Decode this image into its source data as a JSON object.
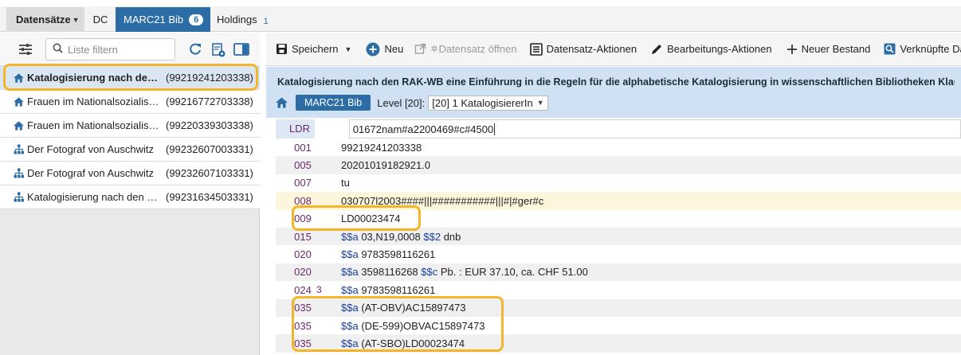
{
  "tabs": {
    "records_label": "Datensätze",
    "dc_label": "DC",
    "marc_label": "MARC21 Bib",
    "marc_count": "6",
    "holdings_label": "Holdings",
    "holdings_count": "1"
  },
  "left_panel": {
    "search_placeholder": "Liste filtern",
    "records": [
      {
        "icon": "home-icon",
        "title": "Katalogisierung nach den RAK-WB eine Einführung",
        "id": "(99219241203338)",
        "selected": true
      },
      {
        "icon": "home-icon",
        "title": "Frauen im Nationalsozialismus",
        "id": "(99216772703338)",
        "selected": false
      },
      {
        "icon": "home-icon",
        "title": "Frauen im Nationalsozialismus",
        "id": "(99220339303338)",
        "selected": false
      },
      {
        "icon": "hierarchy-icon",
        "title": "Der Fotograf von Auschwitz",
        "id": "(99232607003331)",
        "selected": false
      },
      {
        "icon": "hierarchy-icon",
        "title": "Der Fotograf von Auschwitz",
        "id": "(99232607103331)",
        "selected": false
      },
      {
        "icon": "hierarchy-icon",
        "title": "Katalogisierung nach den RAK-WB",
        "id": "(99231634503331)",
        "selected": false
      }
    ]
  },
  "toolbar": {
    "save_label": "Speichern",
    "new_label": "Neu",
    "open_record_label": "Datensatz öffnen",
    "record_actions_label": "Datensatz-Aktionen",
    "edit_actions_label": "Bearbeitungs-Aktionen",
    "new_holding_label": "Neuer Bestand",
    "linked_label": "Verknüpfte Da"
  },
  "record": {
    "title": "Katalogisierung nach den RAK-WB eine Einführung in die Regeln für die alphabetische Katalogisierung in wissenschaftlichen Bibliotheken Klaus H...",
    "format_chip": "MARC21 Bib",
    "level_label": "Level [20]:",
    "level_value": "[20] 1 KatalogisiererIn"
  },
  "marc_fields": [
    {
      "tag": "LDR",
      "ind": "",
      "parts": [
        {
          "t": "text",
          "v": "01672nam#a2200469#c#4500"
        }
      ]
    },
    {
      "tag": "001",
      "ind": "",
      "parts": [
        {
          "t": "text",
          "v": "99219241203338"
        }
      ]
    },
    {
      "tag": "005",
      "ind": "",
      "parts": [
        {
          "t": "text",
          "v": "20201019182921.0"
        }
      ]
    },
    {
      "tag": "007",
      "ind": "",
      "parts": [
        {
          "t": "text",
          "v": "tu"
        }
      ]
    },
    {
      "tag": "008",
      "ind": "",
      "parts": [
        {
          "t": "text",
          "v": "030707l2003####|||###########|||#|#ger#c"
        }
      ]
    },
    {
      "tag": "009",
      "ind": "",
      "parts": [
        {
          "t": "text",
          "v": "LD00023474"
        }
      ]
    },
    {
      "tag": "015",
      "ind": "",
      "parts": [
        {
          "t": "sub",
          "v": "$$a"
        },
        {
          "t": "text",
          "v": " 03,N19,0008 "
        },
        {
          "t": "sub",
          "v": "$$2"
        },
        {
          "t": "text",
          "v": " dnb"
        }
      ]
    },
    {
      "tag": "020",
      "ind": "",
      "parts": [
        {
          "t": "sub",
          "v": "$$a"
        },
        {
          "t": "text",
          "v": " 9783598116261"
        }
      ]
    },
    {
      "tag": "020",
      "ind": "",
      "parts": [
        {
          "t": "sub",
          "v": "$$a"
        },
        {
          "t": "text",
          "v": " 3598116268 "
        },
        {
          "t": "sub",
          "v": "$$c"
        },
        {
          "t": "text",
          "v": " Pb. : EUR 37.10, ca. CHF 51.00"
        }
      ]
    },
    {
      "tag": "024",
      "ind": "3",
      "parts": [
        {
          "t": "sub",
          "v": "$$a"
        },
        {
          "t": "text",
          "v": " 9783598116261"
        }
      ]
    },
    {
      "tag": "035",
      "ind": "",
      "parts": [
        {
          "t": "sub",
          "v": "$$a"
        },
        {
          "t": "text",
          "v": " (AT-OBV)AC15897473"
        }
      ]
    },
    {
      "tag": "035",
      "ind": "",
      "parts": [
        {
          "t": "sub",
          "v": "$$a"
        },
        {
          "t": "text",
          "v": " (DE-599)OBVAC15897473"
        }
      ]
    },
    {
      "tag": "035",
      "ind": "",
      "parts": [
        {
          "t": "sub",
          "v": "$$a"
        },
        {
          "t": "text",
          "v": " (AT-SBO)LD00023474"
        }
      ]
    }
  ],
  "colors": {
    "accent": "#2d6da6",
    "callout": "#f5b52a",
    "header_bg": "#cfe1f3",
    "tag_color": "#6b2a6d",
    "subfield_color": "#1a3f9a"
  }
}
